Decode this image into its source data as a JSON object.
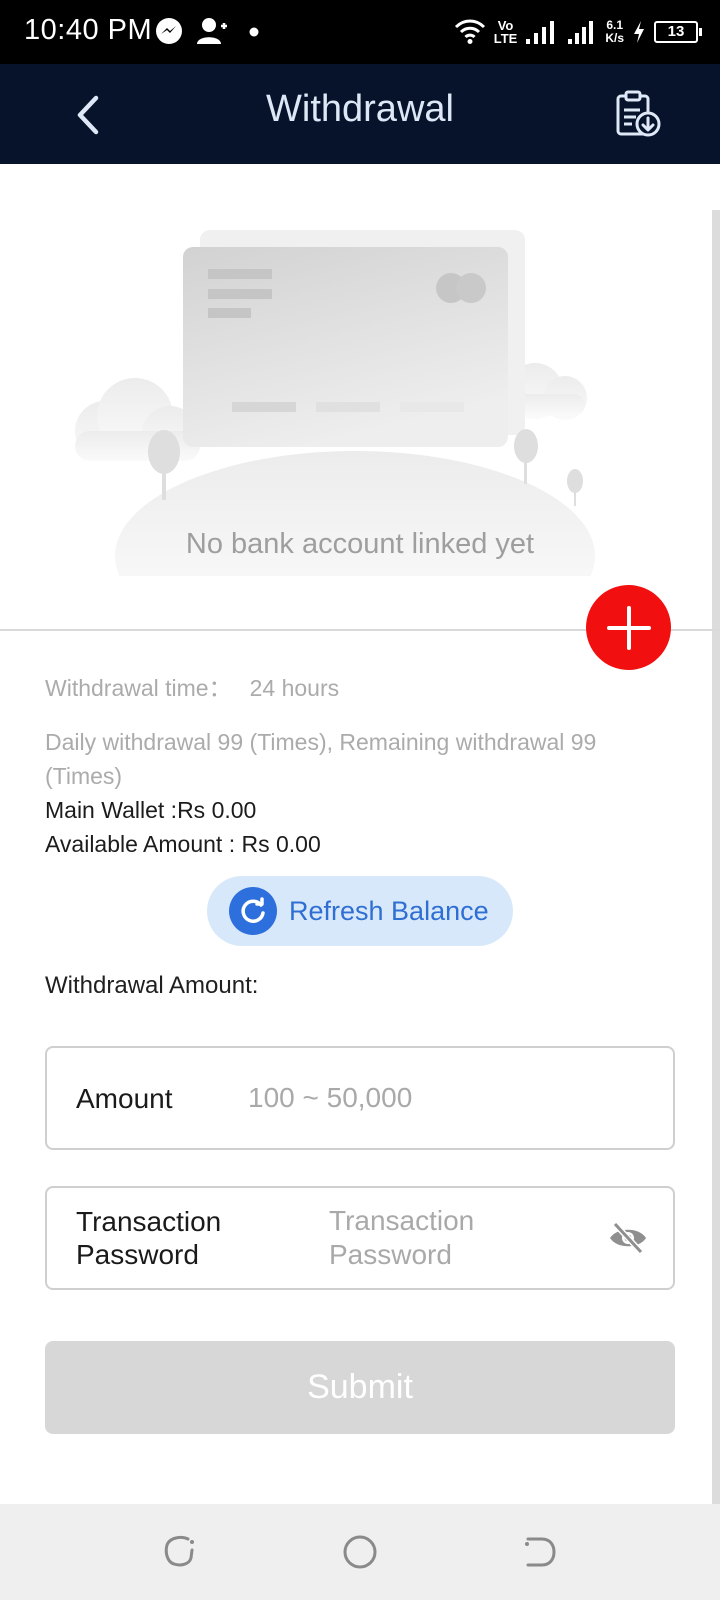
{
  "status_bar": {
    "time": "10:40 PM",
    "network_top": "Vo",
    "network_bottom": "LTE",
    "speed_top": "6.1",
    "speed_bottom": "K/s",
    "battery": "13"
  },
  "header": {
    "title": "Withdrawal"
  },
  "empty_state": {
    "text": "No bank account linked yet"
  },
  "info": {
    "withdrawal_time_label": "Withdrawal time：",
    "withdrawal_time_value": "24 hours",
    "daily_limit_line1": "Daily withdrawal 99 (Times), Remaining withdrawal 99",
    "daily_limit_line2": "(Times)",
    "main_wallet": "Main Wallet :Rs 0.00",
    "available_amount": "Available Amount : Rs 0.00"
  },
  "refresh": {
    "label": "Refresh Balance"
  },
  "form": {
    "amount_heading": "Withdrawal Amount:",
    "amount_label": "Amount",
    "amount_placeholder": "100 ~ 50,000",
    "password_label_line1": "Transaction",
    "password_label_line2": "Password",
    "password_placeholder_line1": "Transaction",
    "password_placeholder_line2": "Password",
    "submit_label": "Submit"
  },
  "colors": {
    "header_bg": "#06132a",
    "add_button": "#f20f0f",
    "refresh_bg": "#d8e8fb",
    "refresh_accent": "#2d6fdc",
    "submit_disabled": "#d7d7d7"
  },
  "icons": {
    "back": "chevron-left-icon",
    "records": "clipboard-download-icon",
    "add": "plus-icon",
    "refresh": "refresh-icon",
    "visibility": "eye-off-icon"
  }
}
